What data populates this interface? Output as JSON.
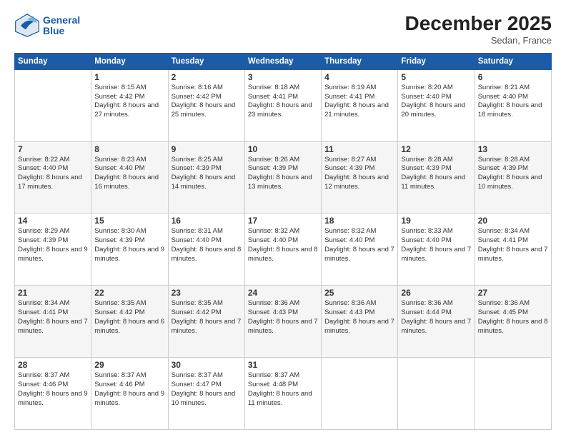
{
  "header": {
    "logo_line1": "General",
    "logo_line2": "Blue",
    "month_title": "December 2025",
    "subtitle": "Sedan, France"
  },
  "days_of_week": [
    "Sunday",
    "Monday",
    "Tuesday",
    "Wednesday",
    "Thursday",
    "Friday",
    "Saturday"
  ],
  "weeks": [
    [
      {
        "day": "",
        "info": ""
      },
      {
        "day": "1",
        "info": "Sunrise: 8:15 AM\nSunset: 4:42 PM\nDaylight: 8 hours\nand 27 minutes."
      },
      {
        "day": "2",
        "info": "Sunrise: 8:16 AM\nSunset: 4:42 PM\nDaylight: 8 hours\nand 25 minutes."
      },
      {
        "day": "3",
        "info": "Sunrise: 8:18 AM\nSunset: 4:41 PM\nDaylight: 8 hours\nand 23 minutes."
      },
      {
        "day": "4",
        "info": "Sunrise: 8:19 AM\nSunset: 4:41 PM\nDaylight: 8 hours\nand 21 minutes."
      },
      {
        "day": "5",
        "info": "Sunrise: 8:20 AM\nSunset: 4:40 PM\nDaylight: 8 hours\nand 20 minutes."
      },
      {
        "day": "6",
        "info": "Sunrise: 8:21 AM\nSunset: 4:40 PM\nDaylight: 8 hours\nand 18 minutes."
      }
    ],
    [
      {
        "day": "7",
        "info": "Sunrise: 8:22 AM\nSunset: 4:40 PM\nDaylight: 8 hours\nand 17 minutes."
      },
      {
        "day": "8",
        "info": "Sunrise: 8:23 AM\nSunset: 4:40 PM\nDaylight: 8 hours\nand 16 minutes."
      },
      {
        "day": "9",
        "info": "Sunrise: 8:25 AM\nSunset: 4:39 PM\nDaylight: 8 hours\nand 14 minutes."
      },
      {
        "day": "10",
        "info": "Sunrise: 8:26 AM\nSunset: 4:39 PM\nDaylight: 8 hours\nand 13 minutes."
      },
      {
        "day": "11",
        "info": "Sunrise: 8:27 AM\nSunset: 4:39 PM\nDaylight: 8 hours\nand 12 minutes."
      },
      {
        "day": "12",
        "info": "Sunrise: 8:28 AM\nSunset: 4:39 PM\nDaylight: 8 hours\nand 11 minutes."
      },
      {
        "day": "13",
        "info": "Sunrise: 8:28 AM\nSunset: 4:39 PM\nDaylight: 8 hours\nand 10 minutes."
      }
    ],
    [
      {
        "day": "14",
        "info": "Sunrise: 8:29 AM\nSunset: 4:39 PM\nDaylight: 8 hours\nand 9 minutes."
      },
      {
        "day": "15",
        "info": "Sunrise: 8:30 AM\nSunset: 4:39 PM\nDaylight: 8 hours\nand 9 minutes."
      },
      {
        "day": "16",
        "info": "Sunrise: 8:31 AM\nSunset: 4:40 PM\nDaylight: 8 hours\nand 8 minutes."
      },
      {
        "day": "17",
        "info": "Sunrise: 8:32 AM\nSunset: 4:40 PM\nDaylight: 8 hours\nand 8 minutes."
      },
      {
        "day": "18",
        "info": "Sunrise: 8:32 AM\nSunset: 4:40 PM\nDaylight: 8 hours\nand 7 minutes."
      },
      {
        "day": "19",
        "info": "Sunrise: 8:33 AM\nSunset: 4:40 PM\nDaylight: 8 hours\nand 7 minutes."
      },
      {
        "day": "20",
        "info": "Sunrise: 8:34 AM\nSunset: 4:41 PM\nDaylight: 8 hours\nand 7 minutes."
      }
    ],
    [
      {
        "day": "21",
        "info": "Sunrise: 8:34 AM\nSunset: 4:41 PM\nDaylight: 8 hours\nand 7 minutes."
      },
      {
        "day": "22",
        "info": "Sunrise: 8:35 AM\nSunset: 4:42 PM\nDaylight: 8 hours\nand 6 minutes."
      },
      {
        "day": "23",
        "info": "Sunrise: 8:35 AM\nSunset: 4:42 PM\nDaylight: 8 hours\nand 7 minutes."
      },
      {
        "day": "24",
        "info": "Sunrise: 8:36 AM\nSunset: 4:43 PM\nDaylight: 8 hours\nand 7 minutes."
      },
      {
        "day": "25",
        "info": "Sunrise: 8:36 AM\nSunset: 4:43 PM\nDaylight: 8 hours\nand 7 minutes."
      },
      {
        "day": "26",
        "info": "Sunrise: 8:36 AM\nSunset: 4:44 PM\nDaylight: 8 hours\nand 7 minutes."
      },
      {
        "day": "27",
        "info": "Sunrise: 8:36 AM\nSunset: 4:45 PM\nDaylight: 8 hours\nand 8 minutes."
      }
    ],
    [
      {
        "day": "28",
        "info": "Sunrise: 8:37 AM\nSunset: 4:46 PM\nDaylight: 8 hours\nand 9 minutes."
      },
      {
        "day": "29",
        "info": "Sunrise: 8:37 AM\nSunset: 4:46 PM\nDaylight: 8 hours\nand 9 minutes."
      },
      {
        "day": "30",
        "info": "Sunrise: 8:37 AM\nSunset: 4:47 PM\nDaylight: 8 hours\nand 10 minutes."
      },
      {
        "day": "31",
        "info": "Sunrise: 8:37 AM\nSunset: 4:48 PM\nDaylight: 8 hours\nand 11 minutes."
      },
      {
        "day": "",
        "info": ""
      },
      {
        "day": "",
        "info": ""
      },
      {
        "day": "",
        "info": ""
      }
    ]
  ]
}
